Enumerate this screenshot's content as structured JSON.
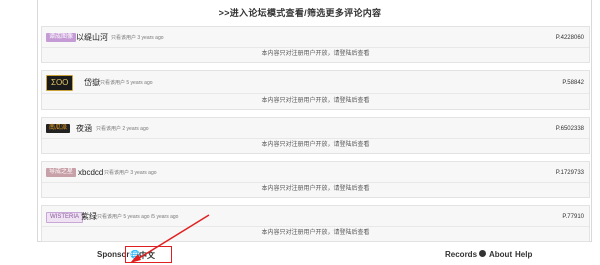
{
  "forum_link": ">>进入论坛模式查看/筛选更多评论内容",
  "colors": {
    "arrow": "#e02020",
    "border": "#d9d9d9",
    "row_bg": "#f7f7f7"
  },
  "comments": [
    {
      "badge": "谭成图像",
      "badge_color": "#c59bd6",
      "username": "以缇山河",
      "meta": "只看该用户 3 years ago",
      "pid": "P.4228060",
      "notice": "本内容只对注册用户开放，请登陆后查看"
    },
    {
      "badge": "ΣOO",
      "badge_color": "#1a1a1a",
      "username": "岱嶽",
      "meta": "只看该用户 5 years ago",
      "pid": "P.58842",
      "notice": "本内容只对注册用户开放，请登陆后查看"
    },
    {
      "badge": "南瓜派",
      "badge_color": "#222222",
      "username": "夜涵",
      "meta": "只看该用户 2 years ago",
      "pid": "P.6502338",
      "notice": "本内容只对注册用户开放，请登陆后查看"
    },
    {
      "badge": "导成之星",
      "badge_color": "#c8a0a8",
      "username": "xbcdcd",
      "meta": "只看该用户 3 years ago",
      "pid": "P.1729733",
      "notice": "本内容只对注册用户开放，请登陆后查看"
    },
    {
      "badge": "WISTERIA",
      "badge_color": "#efe2f2",
      "username": "紫绿",
      "meta": "只看该用户 5 years ago /5 years ago",
      "pid": "P.77910",
      "notice": "本内容只对注册用户开放，请登陆后查看"
    }
  ],
  "footer": {
    "sponsor": "Sponsor",
    "language": "中文",
    "records": "Records",
    "about": "About",
    "help": "Help"
  }
}
